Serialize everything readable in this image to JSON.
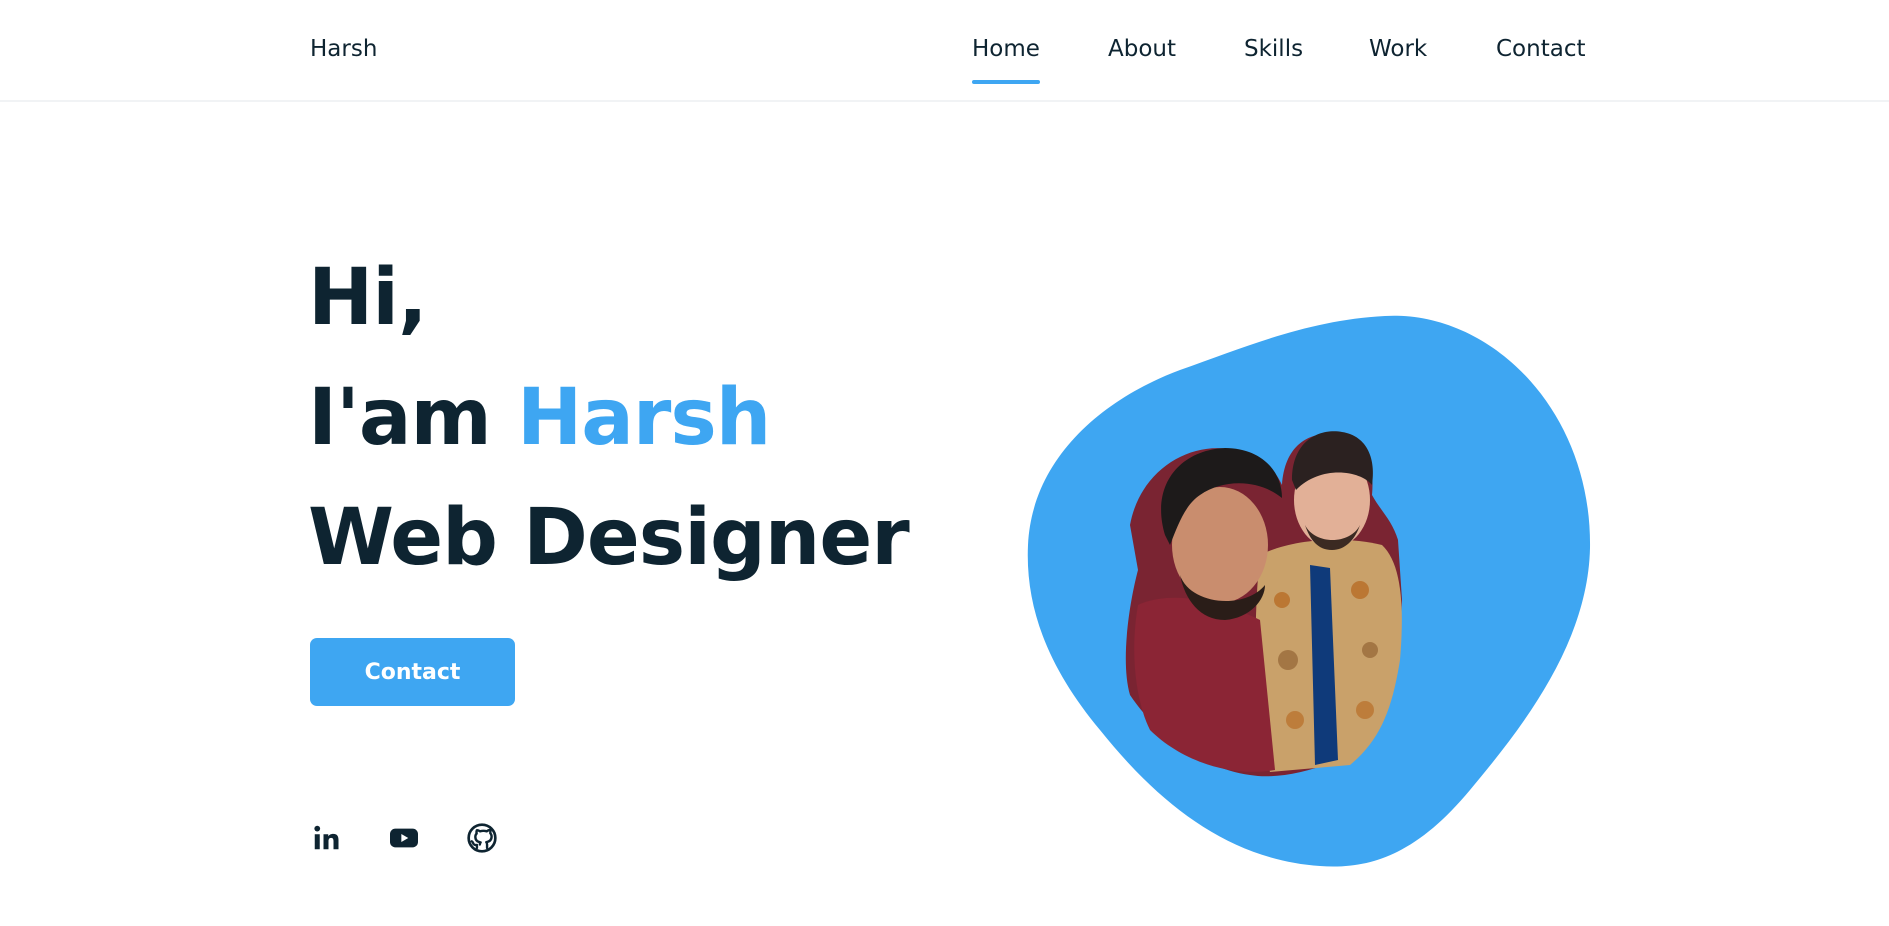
{
  "header": {
    "logo": "Harsh",
    "nav": [
      {
        "label": "Home",
        "active": true
      },
      {
        "label": "About",
        "active": false
      },
      {
        "label": "Skills",
        "active": false
      },
      {
        "label": "Work",
        "active": false
      },
      {
        "label": "Contact",
        "active": false
      }
    ]
  },
  "hero": {
    "line1": "Hi,",
    "line2_prefix": "I'am ",
    "line2_name": "Harsh",
    "line3": "Web Designer",
    "button_label": "Contact"
  },
  "social": [
    {
      "icon": "linkedin-icon"
    },
    {
      "icon": "youtube-icon"
    },
    {
      "icon": "github-icon"
    }
  ],
  "colors": {
    "accent": "#3ea6f2",
    "text": "#0e2431",
    "background": "#ffffff"
  }
}
